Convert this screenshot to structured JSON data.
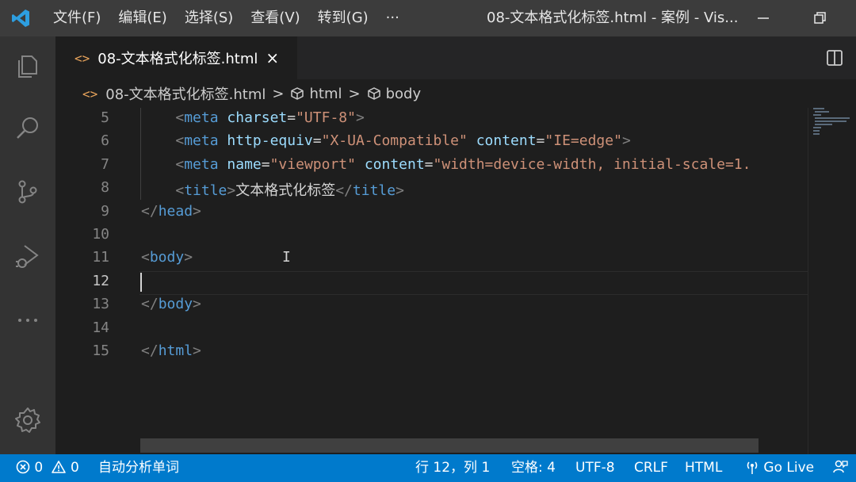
{
  "menu": [
    "文件(F)",
    "编辑(E)",
    "选择(S)",
    "查看(V)",
    "转到(G)",
    "···"
  ],
  "window_title": "08-文本格式化标签.html - 案例 - Vis...",
  "tab": {
    "label": "08-文本格式化标签.html",
    "close": "×",
    "icon_text": "<>"
  },
  "breadcrumb": {
    "file": "08-文本格式化标签.html",
    "html": "html",
    "body": "body",
    "sep": ">"
  },
  "editor": {
    "line_numbers": [
      "5",
      "6",
      "7",
      "8",
      "9",
      "10",
      "11",
      "12",
      "13",
      "14",
      "15"
    ],
    "active_line": "12",
    "lines": [
      [
        {
          "c": "br",
          "t": "    <"
        },
        {
          "c": "tg",
          "t": "meta"
        },
        {
          "c": "tx",
          "t": " "
        },
        {
          "c": "at",
          "t": "charset"
        },
        {
          "c": "tx",
          "t": "="
        },
        {
          "c": "st",
          "t": "\"UTF-8\""
        },
        {
          "c": "br",
          "t": ">"
        }
      ],
      [
        {
          "c": "br",
          "t": "    <"
        },
        {
          "c": "tg",
          "t": "meta"
        },
        {
          "c": "tx",
          "t": " "
        },
        {
          "c": "at",
          "t": "http-equiv"
        },
        {
          "c": "tx",
          "t": "="
        },
        {
          "c": "st",
          "t": "\"X-UA-Compatible\""
        },
        {
          "c": "tx",
          "t": " "
        },
        {
          "c": "at",
          "t": "content"
        },
        {
          "c": "tx",
          "t": "="
        },
        {
          "c": "st",
          "t": "\"IE=edge\""
        },
        {
          "c": "br",
          "t": ">"
        }
      ],
      [
        {
          "c": "br",
          "t": "    <"
        },
        {
          "c": "tg",
          "t": "meta"
        },
        {
          "c": "tx",
          "t": " "
        },
        {
          "c": "at",
          "t": "name"
        },
        {
          "c": "tx",
          "t": "="
        },
        {
          "c": "st",
          "t": "\"viewport\""
        },
        {
          "c": "tx",
          "t": " "
        },
        {
          "c": "at",
          "t": "content"
        },
        {
          "c": "tx",
          "t": "="
        },
        {
          "c": "st",
          "t": "\"width=device-width, initial-scale=1."
        }
      ],
      [
        {
          "c": "br",
          "t": "    <"
        },
        {
          "c": "tg",
          "t": "title"
        },
        {
          "c": "br",
          "t": ">"
        },
        {
          "c": "tx",
          "t": "文本格式化标签"
        },
        {
          "c": "br",
          "t": "</"
        },
        {
          "c": "tg",
          "t": "title"
        },
        {
          "c": "br",
          "t": ">"
        }
      ],
      [
        {
          "c": "br",
          "t": "</"
        },
        {
          "c": "tg",
          "t": "head"
        },
        {
          "c": "br",
          "t": ">"
        }
      ],
      [],
      [
        {
          "c": "br",
          "t": "<"
        },
        {
          "c": "tg",
          "t": "body"
        },
        {
          "c": "br",
          "t": ">"
        }
      ],
      [],
      [
        {
          "c": "br",
          "t": "</"
        },
        {
          "c": "tg",
          "t": "body"
        },
        {
          "c": "br",
          "t": ">"
        }
      ],
      [],
      [
        {
          "c": "br",
          "t": "</"
        },
        {
          "c": "tg",
          "t": "html"
        },
        {
          "c": "br",
          "t": ">"
        }
      ]
    ]
  },
  "status": {
    "errors": "0",
    "warnings": "0",
    "extension": "自动分析单词",
    "position": "行 12，列 1",
    "spaces": "空格: 4",
    "encoding": "UTF-8",
    "eol": "CRLF",
    "language": "HTML",
    "golive": "Go Live"
  },
  "colors": {
    "accent": "#007acc",
    "titlebar": "#3c3c3c",
    "activitybar": "#333333",
    "editor_bg": "#1e1e1e"
  },
  "icons": [
    "vscode-logo-icon",
    "explorer-icon",
    "search-icon",
    "source-control-icon",
    "run-debug-icon",
    "more-icon",
    "settings-gear-icon",
    "split-editor-icon",
    "minimize-icon",
    "restore-icon",
    "error-icon",
    "warning-icon",
    "broadcast-icon",
    "feedback-icon",
    "cube-icon"
  ]
}
